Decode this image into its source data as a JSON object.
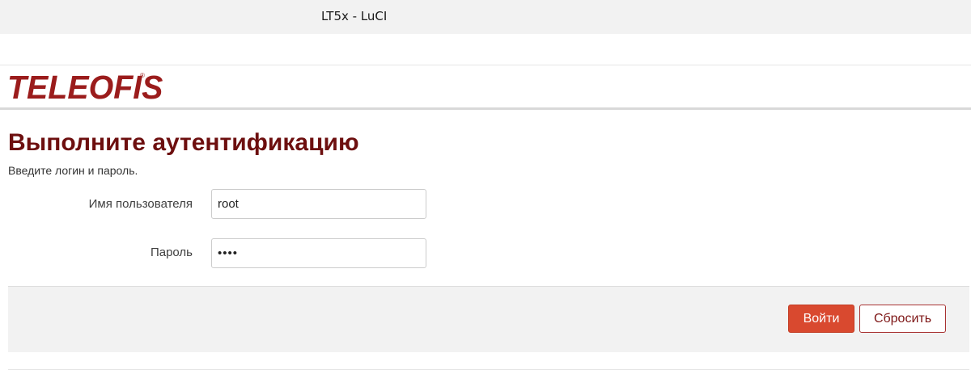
{
  "window": {
    "title": "LT5x - LuCI"
  },
  "header": {
    "logo_text": "TELEOFIS",
    "logo_mark": "®"
  },
  "auth": {
    "title": "Выполните аутентификацию",
    "description": "Введите логин и пароль.",
    "username_label": "Имя пользователя",
    "username_value": "root",
    "password_label": "Пароль",
    "password_value": "••••"
  },
  "actions": {
    "login_label": "Войти",
    "reset_label": "Сбросить"
  },
  "colors": {
    "brand": "#9b1c1c",
    "title": "#6d0f0f",
    "primary_button": "#d9492f"
  }
}
